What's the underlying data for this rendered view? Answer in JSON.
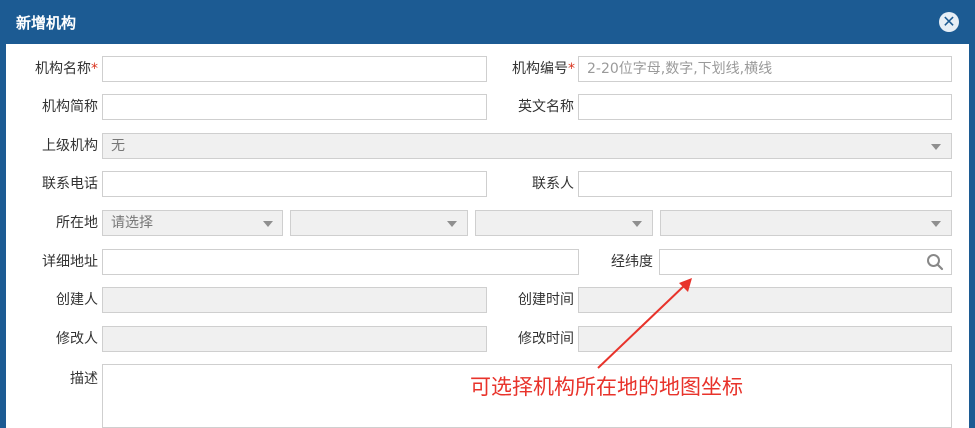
{
  "dialog": {
    "title": "新增机构",
    "close_icon": "close-icon"
  },
  "form": {
    "org_name_label": "机构名称",
    "org_code_label": "机构编号",
    "required_mark": "*",
    "org_code_placeholder": "2-20位字母,数字,下划线,横线",
    "short_name_label": "机构简称",
    "english_name_label": "英文名称",
    "parent_label": "上级机构",
    "parent_value": "无",
    "phone_label": "联系电话",
    "contact_label": "联系人",
    "location_label": "所在地",
    "location_placeholder": "请选择",
    "address_label": "详细地址",
    "latlng_label": "经纬度",
    "creator_label": "创建人",
    "created_time_label": "创建时间",
    "modifier_label": "修改人",
    "modified_time_label": "修改时间",
    "desc_label": "描述"
  },
  "annotation": {
    "text": "可选择机构所在地的地图坐标",
    "color": "#e8332b"
  }
}
